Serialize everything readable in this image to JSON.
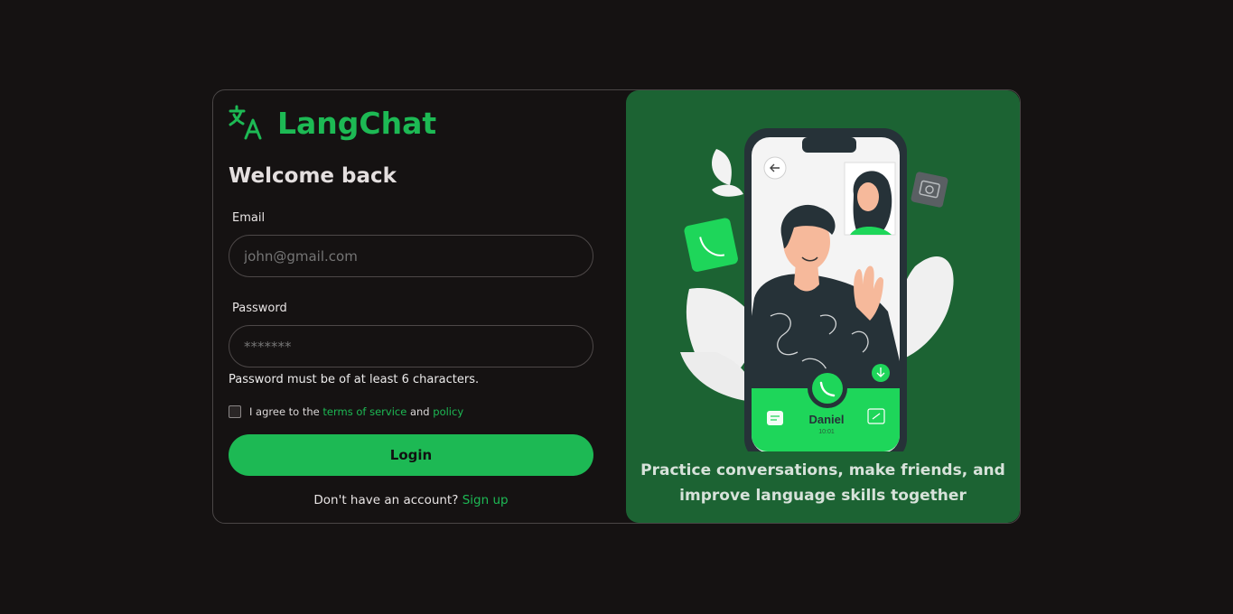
{
  "brand": {
    "name": "LangChat",
    "icon": "translate-icon",
    "color": "#1db954"
  },
  "login": {
    "title": "Welcome back",
    "email_label": "Email",
    "email_placeholder": "john@gmail.com",
    "password_label": "Password",
    "password_placeholder": "*******",
    "password_hint": "Password must be of at least 6 characters.",
    "agree_prefix": "I agree to the",
    "terms_link": "terms of service",
    "agree_and": "and",
    "policy_link": "policy",
    "login_button": "Login",
    "signup_prompt": "Don't have an account?",
    "signup_link": "Sign up"
  },
  "promo": {
    "tagline": "Practice conversations, make friends, and improve language skills together",
    "caller_name": "Daniel",
    "caller_sub": "10:01"
  },
  "colors": {
    "background": "#151212",
    "panel": "#1c6333",
    "accent": "#1db954"
  }
}
